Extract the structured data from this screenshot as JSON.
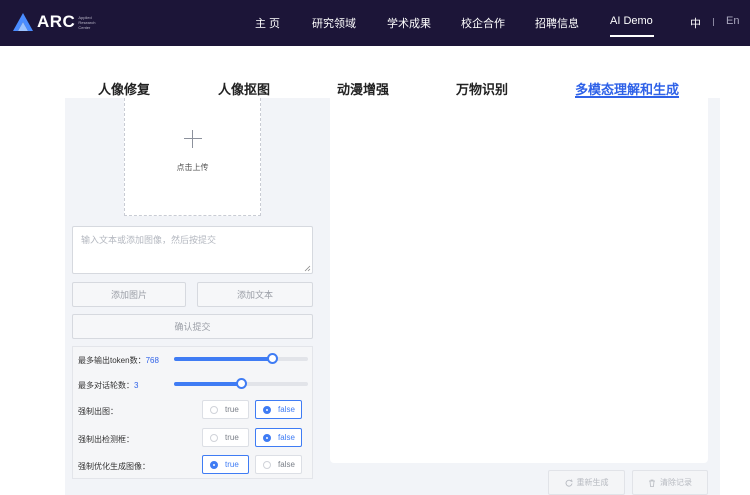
{
  "header": {
    "logo_text": "ARC",
    "logo_subtitle": "Applied Research Center",
    "nav": [
      {
        "label": "主 页"
      },
      {
        "label": "研究领域"
      },
      {
        "label": "学术成果"
      },
      {
        "label": "校企合作"
      },
      {
        "label": "招聘信息"
      },
      {
        "label": "AI Demo",
        "active": true
      }
    ],
    "lang_zh": "中",
    "lang_en": "En"
  },
  "tabs": [
    {
      "label": "人像修复"
    },
    {
      "label": "人像抠图"
    },
    {
      "label": "动漫增强"
    },
    {
      "label": "万物识别"
    },
    {
      "label": "多模态理解和生成",
      "active": true
    }
  ],
  "upload": {
    "label": "点击上传"
  },
  "prompt": {
    "value": "",
    "placeholder": "输入文本或添加图像，然后按提交"
  },
  "buttons": {
    "add_image": "添加图片",
    "add_text": "添加文本",
    "confirm_submit": "确认提交",
    "regenerate": "重新生成",
    "clear_history": "清除记录"
  },
  "settings": {
    "max_tokens_label": "最多输出token数：",
    "max_tokens_value": "768",
    "max_tokens_fraction": 0.73,
    "max_rounds_label": "最多对话轮数：",
    "max_rounds_value": "3",
    "max_rounds_fraction": 0.5,
    "force_image_label": "强制出图：",
    "force_detect_label": "强制出检测框：",
    "force_optimize_label": "强制优化生成图像：",
    "true_label": "true",
    "false_label": "false"
  },
  "colors": {
    "accent": "#2f62e8",
    "header_bg": "#1c1538"
  }
}
